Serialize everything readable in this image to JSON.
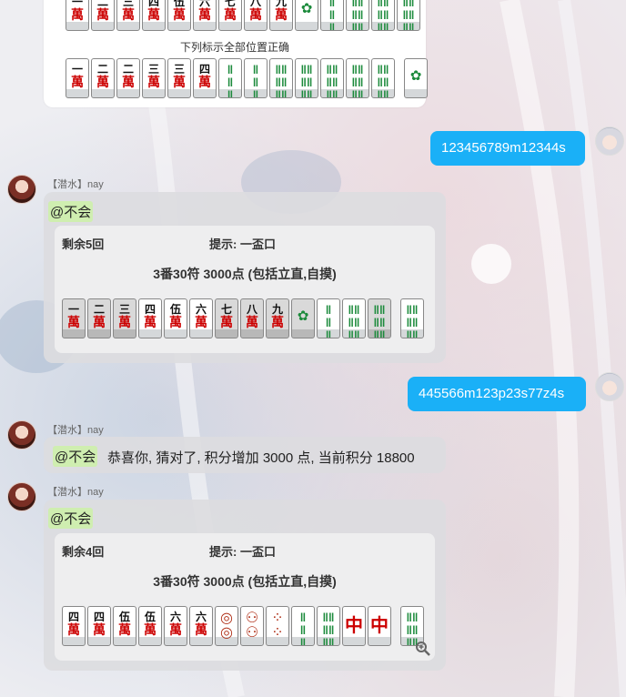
{
  "card_top": {
    "caption": "下列标示全部位置正确",
    "row1": [
      {
        "t": "一",
        "s": "萬"
      },
      {
        "t": "二",
        "s": "萬"
      },
      {
        "t": "三",
        "s": "萬"
      },
      {
        "t": "四",
        "s": "萬"
      },
      {
        "t": "伍",
        "s": "萬"
      },
      {
        "t": "六",
        "s": "萬"
      },
      {
        "t": "七",
        "s": "萬"
      },
      {
        "t": "八",
        "s": "萬"
      },
      {
        "t": "九",
        "s": "萬"
      },
      {
        "t": "🀐",
        "s": ""
      },
      {
        "t": "‖",
        "s": ""
      },
      {
        "t": "‖‖",
        "s": ""
      },
      {
        "t": "‖‖",
        "s": ""
      },
      {
        "t": "‖‖",
        "s": ""
      }
    ],
    "row2": [
      {
        "t": "一",
        "s": "萬"
      },
      {
        "t": "二",
        "s": "萬"
      },
      {
        "t": "二",
        "s": "萬"
      },
      {
        "t": "三",
        "s": "萬"
      },
      {
        "t": "三",
        "s": "萬"
      },
      {
        "t": "四",
        "s": "萬"
      },
      {
        "t": "‖",
        "s": ""
      },
      {
        "t": "‖",
        "s": ""
      },
      {
        "t": "‖‖",
        "s": ""
      },
      {
        "t": "‖‖",
        "s": ""
      },
      {
        "t": "‖‖",
        "s": ""
      },
      {
        "t": "‖‖",
        "s": ""
      },
      {
        "t": "‖‖",
        "s": ""
      },
      {
        "t": "🀐",
        "s": ""
      }
    ]
  },
  "msg_me_1": {
    "text": "123456789m12344s"
  },
  "msg_bot_1": {
    "sender": "【潜水】nay",
    "mention": "@不会",
    "remaining": "剩余5回",
    "hint": "提示: 一盃口",
    "points": "3番30符 3000点 (包括立直,自摸)",
    "tiles": [
      {
        "t": "一",
        "s": "萬",
        "g": true
      },
      {
        "t": "二",
        "s": "萬",
        "g": true
      },
      {
        "t": "三",
        "s": "萬",
        "g": true
      },
      {
        "t": "四",
        "s": "萬"
      },
      {
        "t": "伍",
        "s": "萬"
      },
      {
        "t": "六",
        "s": "萬"
      },
      {
        "t": "七",
        "s": "萬",
        "g": true
      },
      {
        "t": "八",
        "s": "萬",
        "g": true
      },
      {
        "t": "九",
        "s": "萬",
        "g": true
      },
      {
        "t": "🀐",
        "s": "",
        "g": true
      },
      {
        "t": "‖",
        "s": ""
      },
      {
        "t": "‖‖",
        "s": ""
      },
      {
        "t": "‖‖",
        "s": "",
        "g": true
      },
      {
        "t": "‖‖",
        "s": ""
      }
    ]
  },
  "msg_me_2": {
    "text": "445566m123p23s77z4s"
  },
  "msg_bot_2": {
    "sender": "【潜水】nay",
    "mention": "@不会",
    "text": "恭喜你, 猜对了, 积分增加 3000 点, 当前积分 18800"
  },
  "msg_bot_3": {
    "sender": "【潜水】nay",
    "mention": "@不会",
    "remaining": "剩余4回",
    "hint": "提示: 一盃口",
    "points": "3番30符 3000点 (包括立直,自摸)",
    "tiles": [
      {
        "t": "四",
        "s": "萬"
      },
      {
        "t": "四",
        "s": "萬"
      },
      {
        "t": "伍",
        "s": "萬"
      },
      {
        "t": "伍",
        "s": "萬"
      },
      {
        "t": "六",
        "s": "萬"
      },
      {
        "t": "六",
        "s": "萬"
      },
      {
        "t": "◎",
        "s": ""
      },
      {
        "t": "⚇",
        "s": ""
      },
      {
        "t": "⁘",
        "s": ""
      },
      {
        "t": "‖",
        "s": ""
      },
      {
        "t": "‖‖",
        "s": ""
      },
      {
        "t": "中",
        "s": ""
      },
      {
        "t": "中",
        "s": ""
      },
      {
        "t": "‖‖",
        "s": ""
      }
    ]
  },
  "icons": {
    "zoom": "magnifier-plus-icon"
  }
}
